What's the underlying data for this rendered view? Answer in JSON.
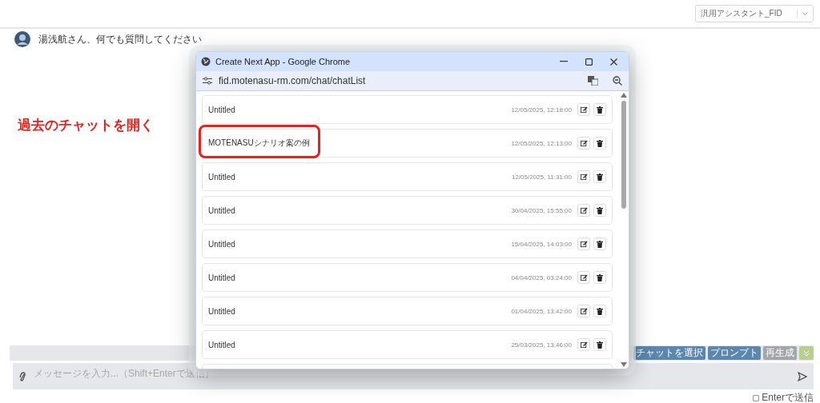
{
  "header": {
    "assistant_select": {
      "value": "汎用アシスタント_FID"
    }
  },
  "greeting": {
    "text": "湯浅航さん、何でも質問してください"
  },
  "annotation": {
    "text": "過去のチャットを開く"
  },
  "popup": {
    "title": "Create Next App - Google Chrome",
    "url": "fid.motenasu-rm.com/chat/chatList",
    "chats": [
      {
        "title": "Untitled",
        "time": "12/05/2025, 12:18:00",
        "highlighted": false
      },
      {
        "title": "MOTENASUシナリオ案の例",
        "time": "12/05/2025, 12:13:00",
        "highlighted": true
      },
      {
        "title": "Untitled",
        "time": "12/05/2025, 11:31:00",
        "highlighted": false
      },
      {
        "title": "Untitled",
        "time": "30/04/2025, 15:55:00",
        "highlighted": false
      },
      {
        "title": "Untitled",
        "time": "15/04/2025, 14:03:00",
        "highlighted": false
      },
      {
        "title": "Untitled",
        "time": "04/04/2025, 03:24:00",
        "highlighted": false
      },
      {
        "title": "Untitled",
        "time": "01/04/2025, 13:42:00",
        "highlighted": false
      },
      {
        "title": "Untitled",
        "time": "25/03/2025, 13:46:00",
        "highlighted": false
      }
    ]
  },
  "toolbar_buttons": [
    {
      "kind": "primary",
      "label": "チャットを選択"
    },
    {
      "kind": "primary",
      "label": "プロンプト"
    },
    {
      "kind": "muted",
      "label": "再生成"
    },
    {
      "kind": "expand"
    }
  ],
  "composer": {
    "placeholder": "メッセージを入力...（Shift+Enterで送信）",
    "enter_to_send": {
      "label": "Enterで送信",
      "checked": false
    }
  }
}
